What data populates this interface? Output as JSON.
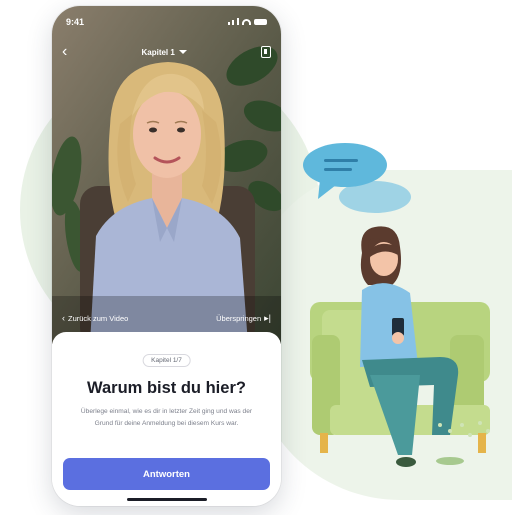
{
  "status_bar": {
    "time": "9:41"
  },
  "nav": {
    "chapter_select": "Kapitel 1"
  },
  "video": {
    "back_to_video": "Zurück zum Video",
    "skip": "Überspringen"
  },
  "question_sheet": {
    "chapter_badge": "Kapitel 1/7",
    "title": "Warum bist du hier?",
    "body": "Überlege einmal, wie es dir in letzter Zeit ging und was der Grund für deine Anmeldung bei diesem Kurs war.",
    "answer_button": "Antworten"
  },
  "colors": {
    "primary_button": "#5b6fe0",
    "speech_bubble": "#5fb8dc",
    "sofa": "#c4dc8e",
    "background_blob": "#e9f2e6"
  },
  "icons": [
    "back-chevron-icon",
    "caret-down-icon",
    "document-icon",
    "rewind-icon",
    "skip-forward-icon"
  ]
}
